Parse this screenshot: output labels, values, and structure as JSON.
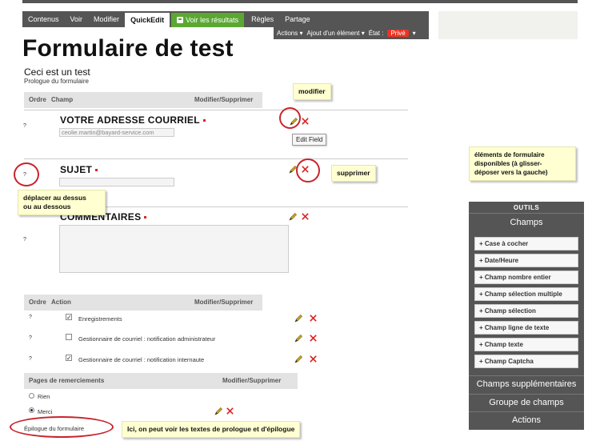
{
  "tabs": [
    {
      "label": "Contenus"
    },
    {
      "label": "Voir"
    },
    {
      "label": "Modifier"
    },
    {
      "label": "QuickEdit"
    },
    {
      "label": "Voir les résultats"
    },
    {
      "label": "Règles"
    },
    {
      "label": "Partage"
    }
  ],
  "subbar": {
    "actions": "Actions ▾",
    "add": "Ajout d'un élément ▾",
    "state_label": "État :",
    "state_value": "Privé",
    "arrow": "▾"
  },
  "form": {
    "title": "Formulaire de test",
    "subtitle": "Ceci est un test",
    "prologue": "Prologue du formulaire",
    "epilogue": "Épilogue du formulaire"
  },
  "fields_header": {
    "order": "Ordre",
    "field": "Champ",
    "edit": "Modifier/Supprimer"
  },
  "fields": [
    {
      "label": "VOTRE ADRESSE COURRIEL",
      "value": "ceolie.martin@bayard-service.com",
      "drag": "?"
    },
    {
      "label": "SUJET",
      "value": "",
      "drag": "?"
    },
    {
      "label": "COMMENTAIRES",
      "value": "",
      "drag": "?"
    }
  ],
  "actions_header": {
    "order": "Ordre",
    "action": "Action",
    "edit": "Modifier/Supprimer"
  },
  "actions": [
    {
      "label": "Enregistrements",
      "checked": true,
      "drag": "?"
    },
    {
      "label": "Gestionnaire de courriel : notification administrateur",
      "checked": false,
      "drag": "?"
    },
    {
      "label": "Gestionnaire de courriel : notification internaute",
      "checked": true,
      "drag": "?"
    }
  ],
  "thanks_header": {
    "pages": "Pages de remerciements",
    "edit": "Modifier/Supprimer"
  },
  "thanks": [
    {
      "label": "Rien",
      "selected": false
    },
    {
      "label": "Merci",
      "selected": true
    }
  ],
  "annotations": {
    "modify": "modifier",
    "edit_tooltip": "Edit Field",
    "delete": "supprimer",
    "move": "déplacer au dessus\nou au dessous",
    "elements": "éléments de formulaire\ndisponibles (à glisser-\ndéposer vers la gauche)",
    "prologue_note": "Ici, on peut voir les textes de prologue et d'épilogue"
  },
  "tools": {
    "title": "OUTILS",
    "section": "Champs",
    "items": [
      "+ Case à cocher",
      "+ Date/Heure",
      "+ Champ nombre entier",
      "+ Champ sélection multiple",
      "+ Champ sélection",
      "+ Champ ligne de texte",
      "+ Champ texte",
      "+ Champ Captcha"
    ],
    "extra": "Champs supplémentaires",
    "group": "Groupe de champs",
    "actions": "Actions"
  },
  "colors": {
    "accent_green": "#5aa832",
    "state_red": "#ee3322",
    "annotation_red": "#c8242b",
    "toolbar_gray": "#555555",
    "note_yellow": "#ffffd2"
  },
  "icons": {
    "edit": "pencil-icon",
    "delete": "delete-x-icon",
    "save": "disk-icon"
  }
}
